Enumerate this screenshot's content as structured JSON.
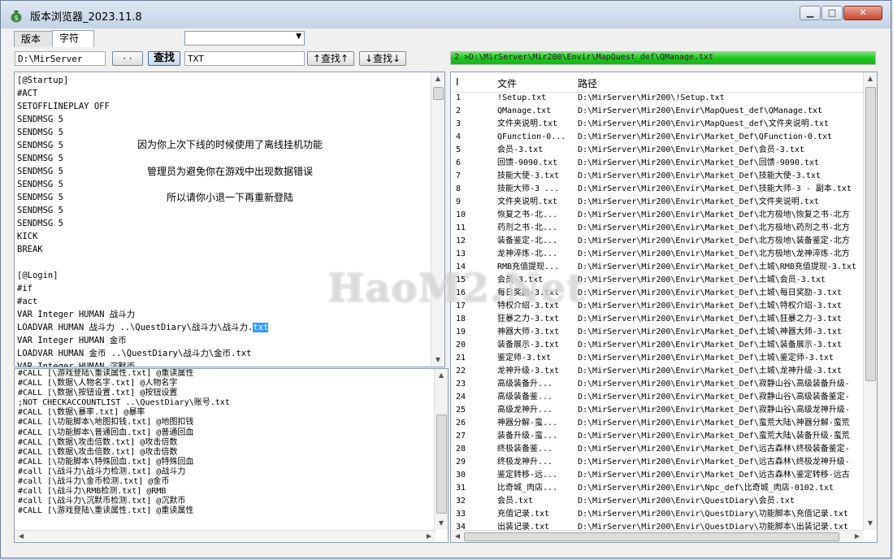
{
  "window": {
    "title": "版本浏览器_2023.11.8"
  },
  "tabs": [
    {
      "label": "版本"
    },
    {
      "label": "字符"
    }
  ],
  "toolbar": {
    "path_value": "D:\\MirServer",
    "browse_label": "· ·",
    "find_label": "查找",
    "ext_value": "TXT",
    "find_up_label": "↑查找↑",
    "find_down_label": "↓查找↓",
    "progress_text": "2 >D:\\MirServer\\Mir200\\Envir\\MapQuest_def\\QManage.txt",
    "progress_fraction": 1.0
  },
  "editor": {
    "lines": [
      "[@Startup]",
      "#ACT",
      "SETOFFLINEPLAY OFF",
      "SENDMSG 5",
      "SENDMSG 5",
      "SENDMSG 5",
      "SENDMSG 5",
      "SENDMSG 5",
      "SENDMSG 5",
      "SENDMSG 5",
      "SENDMSG 5",
      "SENDMSG 5",
      "KICK",
      "BREAK",
      "",
      "[@Login]",
      "#if",
      "#act",
      "VAR Integer HUMAN 战斗力"
    ],
    "line_sel_pre": "LOADVAR HUMAN 战斗力 ..\\QuestDiary\\战斗力\\战斗力.",
    "line_sel_hl": "txt",
    "lines_after": [
      "VAR Integer HUMAN 金币",
      "LOADVAR HUMAN 金币 ..\\QuestDiary\\战斗力\\金币.txt",
      "VAR Integer HUMAN 沉默币"
    ],
    "messages": [
      "因为你上次下线的时候使用了离线挂机功能",
      "管理员为避免你在游戏中出现数据错误",
      "所以请你小退一下再重新登陆"
    ]
  },
  "calls": {
    "lines": [
      "#CALL [\\游戏登陆\\重读属性.txt] @重读属性",
      "#CALL [\\数据\\人物名字.txt] @人物名字",
      "#CALL [\\数据\\按钮设置.txt] @按钮设置",
      ";NOT CHECKACCOUNTLIST ..\\QuestDiary\\账号.txt",
      "#CALL [\\数据\\暴率.txt] @暴率",
      "#CALL [\\功能脚本\\地图扣钱.txt] @地图扣钱",
      "#CALL [\\功能脚本\\普通回血.txt] @普通回血",
      "#CALL [\\数据\\攻击倍数.txt] @攻击倍数",
      "#CALL [\\数据\\攻击倍数.txt] @攻击倍数",
      "#CALL [\\功能脚本\\特殊回血.txt] @特殊回血",
      "#call [\\战斗力\\战斗力检测.txt] @战斗力",
      "#call [\\战斗力\\金币检测.txt] @金币",
      "#call [\\战斗力\\RMB检测.txt] @RMB",
      "#call [\\战斗力\\沉默币检测.txt] @沉默币",
      "#CALL [\\游戏登陆\\重读属性.txt] @重读属性"
    ]
  },
  "file_list": {
    "headers": {
      "index": "I",
      "file": "文件",
      "path": "路径"
    },
    "rows": [
      [
        "1",
        "!Setup.txt",
        "D:\\MirServer\\Mir200\\!Setup.txt"
      ],
      [
        "2",
        "QManage.txt",
        "D:\\MirServer\\Mir200\\Envir\\MapQuest_def\\QManage.txt"
      ],
      [
        "3",
        "文件夹说明.txt",
        "D:\\MirServer\\Mir200\\Envir\\MapQuest_def\\文件夹说明.txt"
      ],
      [
        "4",
        "QFunction-0...",
        "D:\\MirServer\\Mir200\\Envir\\Market_Def\\QFunction-0.txt"
      ],
      [
        "5",
        "会员-3.txt",
        "D:\\MirServer\\Mir200\\Envir\\Market_Def\\会员-3.txt"
      ],
      [
        "6",
        "回馈-9090.txt",
        "D:\\MirServer\\Mir200\\Envir\\Market_Def\\回馈-9090.txt"
      ],
      [
        "7",
        "技能大使-3.txt",
        "D:\\MirServer\\Mir200\\Envir\\Market_Def\\技能大使-3.txt"
      ],
      [
        "8",
        "技能大师-3 ...",
        "D:\\MirServer\\Mir200\\Envir\\Market_Def\\技能大师-3 - 副本.txt"
      ],
      [
        "9",
        "文件夹说明.txt",
        "D:\\MirServer\\Mir200\\Envir\\Market_Def\\文件夹说明.txt"
      ],
      [
        "10",
        "恢复之书-北...",
        "D:\\MirServer\\Mir200\\Envir\\Market_Def\\北方极地\\恢复之书-北方"
      ],
      [
        "11",
        "药剂之书-北...",
        "D:\\MirServer\\Mir200\\Envir\\Market_Def\\北方极地\\药剂之书-北方"
      ],
      [
        "12",
        "装备鉴定-北...",
        "D:\\MirServer\\Mir200\\Envir\\Market_Def\\北方极地\\装备鉴定-北方"
      ],
      [
        "13",
        "龙神淬炼-北...",
        "D:\\MirServer\\Mir200\\Envir\\Market_Def\\北方极地\\龙神淬炼-北方"
      ],
      [
        "14",
        "RMB充值提现...",
        "D:\\MirServer\\Mir200\\Envir\\Market_Def\\土城\\RMB充值提现-3.txt"
      ],
      [
        "15",
        "会员-3.txt",
        "D:\\MirServer\\Mir200\\Envir\\Market_Def\\土城\\会员-3.txt"
      ],
      [
        "16",
        "每日奖励-3.txt",
        "D:\\MirServer\\Mir200\\Envir\\Market_Def\\土城\\每日奖励-3.txt"
      ],
      [
        "17",
        "特权介绍-3.txt",
        "D:\\MirServer\\Mir200\\Envir\\Market_Def\\土城\\特权介绍-3.txt"
      ],
      [
        "18",
        "狂暴之力-3.txt",
        "D:\\MirServer\\Mir200\\Envir\\Market_Def\\土城\\狂暴之力-3.txt"
      ],
      [
        "19",
        "神器大师-3.txt",
        "D:\\MirServer\\Mir200\\Envir\\Market_Def\\土城\\神器大师-3.txt"
      ],
      [
        "20",
        "装备展示-3.txt",
        "D:\\MirServer\\Mir200\\Envir\\Market_Def\\土城\\装备展示-3.txt"
      ],
      [
        "21",
        "鉴定师-3.txt",
        "D:\\MirServer\\Mir200\\Envir\\Market_Def\\土城\\鉴定师-3.txt"
      ],
      [
        "22",
        "龙神升级-3.txt",
        "D:\\MirServer\\Mir200\\Envir\\Market_Def\\土城\\龙神升级-3.txt"
      ],
      [
        "23",
        "高级装备升...",
        "D:\\MirServer\\Mir200\\Envir\\Market_Def\\寂静山谷\\高级装备升级-"
      ],
      [
        "24",
        "高级装备鉴...",
        "D:\\MirServer\\Mir200\\Envir\\Market_Def\\寂静山谷\\高级装备鉴定-"
      ],
      [
        "25",
        "高级龙神升...",
        "D:\\MirServer\\Mir200\\Envir\\Market_Def\\寂静山谷\\高级龙神升级-"
      ],
      [
        "26",
        "神器分解-蛮...",
        "D:\\MirServer\\Mir200\\Envir\\Market_Def\\蛮荒大陆\\神器分解-蛮荒"
      ],
      [
        "27",
        "装备升级-蛮...",
        "D:\\MirServer\\Mir200\\Envir\\Market_Def\\蛮荒大陆\\装备升级-蛮荒"
      ],
      [
        "28",
        "终极装备鉴...",
        "D:\\MirServer\\Mir200\\Envir\\Market_Def\\远古森林\\终极装备鉴定-"
      ],
      [
        "29",
        "终极龙神升...",
        "D:\\MirServer\\Mir200\\Envir\\Market_Def\\远古森林\\终极龙神升级-"
      ],
      [
        "30",
        "鉴定转移-远...",
        "D:\\MirServer\\Mir200\\Envir\\Market_Def\\远古森林\\鉴定转移-远古"
      ],
      [
        "31",
        "比奇城_肉店...",
        "D:\\MirServer\\Mir200\\Envir\\Npc_def\\比奇城_肉店-0102.txt"
      ],
      [
        "32",
        "会员.txt",
        "D:\\MirServer\\Mir200\\Envir\\QuestDiary\\会员.txt"
      ],
      [
        "33",
        "充值记录.txt",
        "D:\\MirServer\\Mir200\\Envir\\QuestDiary\\功能脚本\\充值记录.txt"
      ],
      [
        "34",
        "出装记录.txt",
        "D:\\MirServer\\Mir200\\Envir\\QuestDiary\\功能脚本\\出装记录.txt"
      ]
    ]
  },
  "watermark": "HaoM2.Net",
  "colors": {
    "progress_green": "#1ec71e",
    "selection_blue": "#3399ff",
    "close_red": "#c9452f"
  }
}
